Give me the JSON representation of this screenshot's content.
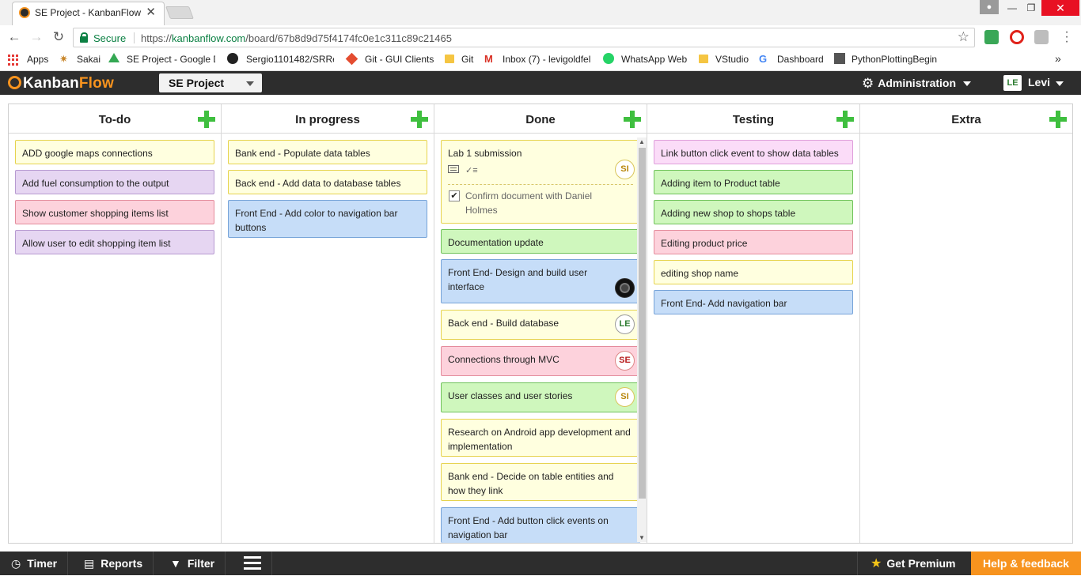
{
  "browser": {
    "tab_title": "SE Project - KanbanFlow",
    "tab_close": "✕",
    "secure_label": "Secure",
    "url_scheme": "https://",
    "url_host": "kanbanflow.com",
    "url_path": "/board/67b8d9d75f4174fc0e1c311c89c21465",
    "bookmarks": [
      "Apps",
      "Sakai",
      "SE Project - Google D",
      "Sergio1101482/SRRe",
      "Git - GUI Clients",
      "Git",
      "Inbox (7) - levigoldfel",
      "WhatsApp Web",
      "VStudio",
      "Dashboard",
      "PythonPlottingBegin"
    ]
  },
  "app": {
    "logo_kanban": "Kanban",
    "logo_flow": "Flow",
    "board_name": "SE Project",
    "admin_label": "Administration",
    "user_initials": "LE",
    "user_name": "Levi"
  },
  "columns": [
    {
      "title": "To-do",
      "cards": [
        {
          "text": "ADD google maps connections",
          "color": "yellow"
        },
        {
          "text": "Add fuel consumption to the output",
          "color": "purple"
        },
        {
          "text": "Show customer shopping items list",
          "color": "red"
        },
        {
          "text": "Allow user to edit shopping item list",
          "color": "purple"
        }
      ]
    },
    {
      "title": "In progress",
      "cards": [
        {
          "text": "Bank end - Populate data tables",
          "color": "yellow"
        },
        {
          "text": "Back end - Add data to database tables",
          "color": "yellow"
        },
        {
          "text": "Front End - Add color to navigation bar buttons",
          "color": "blue"
        }
      ]
    },
    {
      "title": "Done",
      "cards": [
        {
          "text": "Lab 1 submission",
          "color": "yellow",
          "badge": "SI",
          "subtask": "Confirm document with Daniel Holmes",
          "subtask_checked": "✔"
        },
        {
          "text": "Documentation update",
          "color": "green"
        },
        {
          "text": "Front End- Design and build user interface",
          "color": "blue",
          "badge": "avatar-image"
        },
        {
          "text": "Back end - Build database",
          "color": "yellow",
          "badge": "LE"
        },
        {
          "text": "Connections through MVC",
          "color": "red",
          "badge": "SE"
        },
        {
          "text": "User classes and user stories",
          "color": "green",
          "badge": "SI"
        },
        {
          "text": "Research on Android app development and implementation",
          "color": "yellow"
        },
        {
          "text": "Bank end - Decide on table entities and how they link",
          "color": "yellow"
        },
        {
          "text": "Front End - Add button click events on navigation bar",
          "color": "blue"
        }
      ]
    },
    {
      "title": "Testing",
      "cards": [
        {
          "text": "Link button click event to show data tables",
          "color": "pink"
        },
        {
          "text": "Adding item to Product table",
          "color": "green"
        },
        {
          "text": "Adding new shop to shops table",
          "color": "green"
        },
        {
          "text": "Editing product price",
          "color": "red"
        },
        {
          "text": "editing shop name",
          "color": "yellow"
        },
        {
          "text": "Front End- Add navigation bar",
          "color": "blue"
        }
      ]
    },
    {
      "title": "Extra",
      "cards": []
    }
  ],
  "footer": {
    "timer": "Timer",
    "reports": "Reports",
    "filter": "Filter",
    "premium": "Get Premium",
    "help": "Help & feedback"
  },
  "colors": {
    "accent": "#f7931e",
    "header_bg": "#2d2d2d",
    "add_green": "#3fbf3f"
  }
}
